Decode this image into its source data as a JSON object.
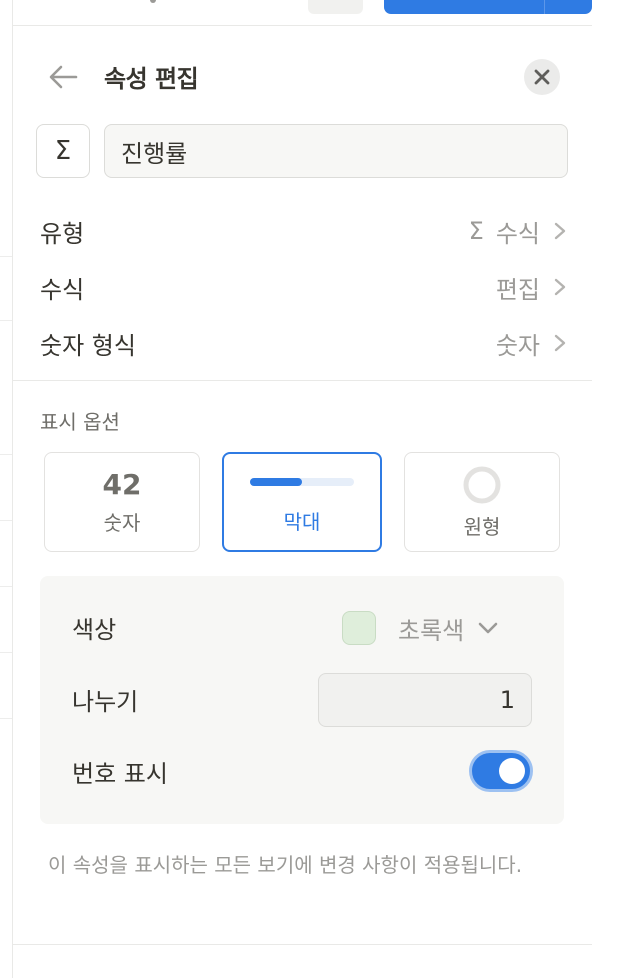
{
  "header": {
    "title": "속성 편집"
  },
  "name_field": {
    "icon": "sigma-icon",
    "icon_glyph": "Σ",
    "value": "진행률"
  },
  "properties": [
    {
      "label": "유형",
      "value": "수식",
      "value_icon": "Σ"
    },
    {
      "label": "수식",
      "value": "편집"
    },
    {
      "label": "숫자 형식",
      "value": "숫자"
    }
  ],
  "display_options": {
    "section_label": "표시 옵션",
    "options": [
      {
        "preview": "42",
        "label": "숫자",
        "selected": false
      },
      {
        "label": "막대",
        "selected": true,
        "bar_fill": 0.5
      },
      {
        "label": "원형",
        "selected": false
      }
    ]
  },
  "settings": {
    "color_label": "색상",
    "color_value": "초록색",
    "color_swatch": "#dfeedb",
    "divide_label": "나누기",
    "divide_value": "1",
    "show_number_label": "번호 표시",
    "show_number_on": true
  },
  "note": "이 속성을 표시하는 모든 보기에 변경 사항이 적용됩니다.",
  "colors": {
    "accent": "#2f7be3",
    "text": "#37352f",
    "muted": "#9b9a97"
  }
}
